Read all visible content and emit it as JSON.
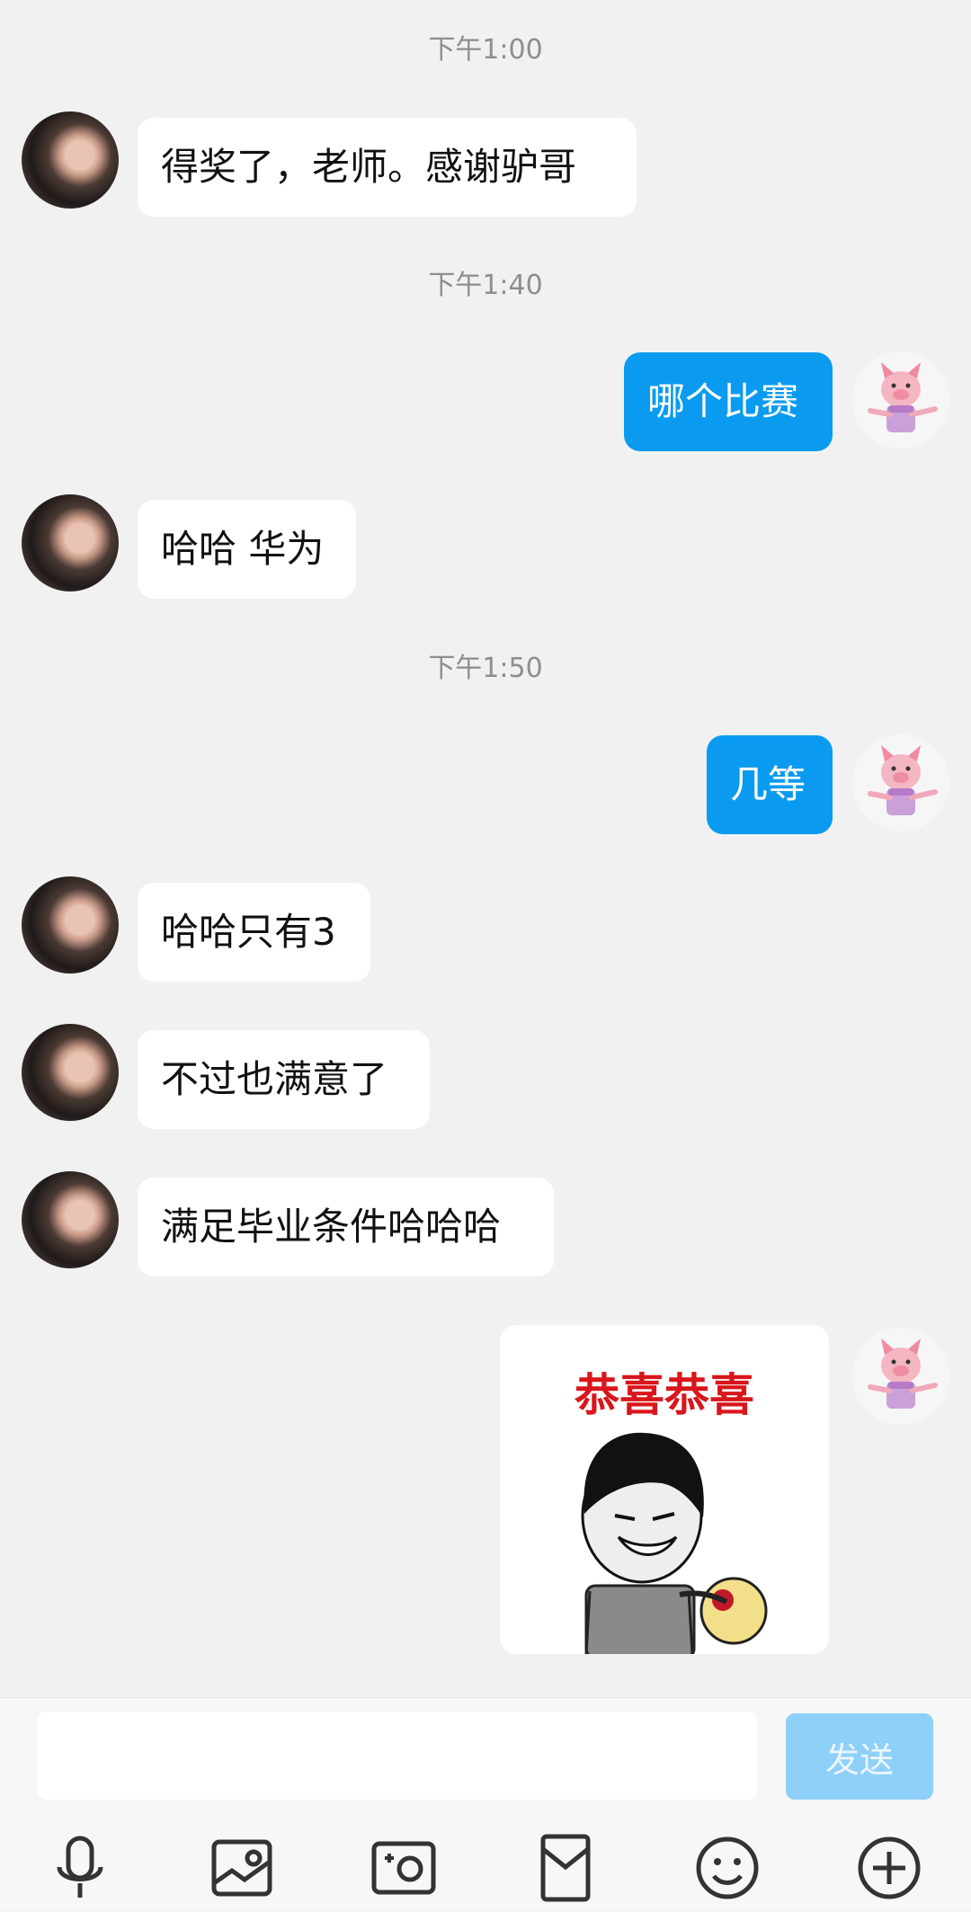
{
  "messages": [
    {
      "type": "time",
      "text": "下午1:00"
    },
    {
      "type": "text",
      "from": "them",
      "text": "得奖了，老师。感谢驴哥"
    },
    {
      "type": "time",
      "text": "下午1:40"
    },
    {
      "type": "text",
      "from": "me",
      "text": "哪个比赛"
    },
    {
      "type": "text",
      "from": "them",
      "text": "哈哈 华为"
    },
    {
      "type": "time",
      "text": "下午1:50"
    },
    {
      "type": "text",
      "from": "me",
      "text": "几等"
    },
    {
      "type": "text",
      "from": "them",
      "text": "哈哈只有3"
    },
    {
      "type": "text",
      "from": "them",
      "text": "不过也满意了"
    },
    {
      "type": "text",
      "from": "them",
      "text": "满足毕业条件哈哈哈"
    },
    {
      "type": "sticker",
      "from": "me",
      "text": "恭喜恭喜"
    }
  ],
  "input": {
    "placeholder": "",
    "value": "",
    "send_label": "发送"
  },
  "toolbar": [
    "microphone-icon",
    "image-icon",
    "camera-icon",
    "red-packet-icon",
    "emoji-icon",
    "plus-icon"
  ],
  "colors": {
    "background": "#f1f1f1",
    "outgoing_bubble": "#0a9bf0",
    "incoming_bubble": "#ffffff",
    "send_button": "#8fd0f8",
    "time": "#8e8e8e"
  }
}
